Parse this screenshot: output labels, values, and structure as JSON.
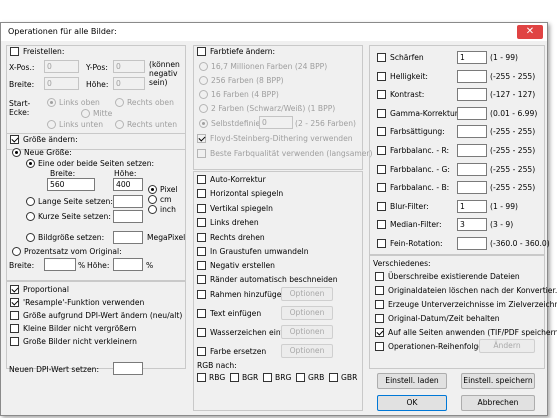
{
  "dialog": {
    "title": "Operationen für alle Bilder:",
    "close_glyph": "✕"
  },
  "freistellen": {
    "checkbox_label": "Freistellen:",
    "xpos_label": "X-Pos.:",
    "xpos_value": "0",
    "ypos_label": "Y-Pos:",
    "ypos_value": "0",
    "negativ_note": "(können negativ sein)",
    "breite_label": "Breite:",
    "breite_value": "0",
    "hoehe_label": "Höhe:",
    "hoehe_value": "0",
    "startecke_label": "Start-Ecke:",
    "options": {
      "links_oben": "Links oben",
      "rechts_oben": "Rechts oben",
      "mitte": "Mitte",
      "links_unten": "Links unten",
      "rechts_unten": "Rechts unten"
    }
  },
  "groesse": {
    "checkbox_label": "Größe ändern:",
    "neue_groesse": "Neue Größe:",
    "eine_oder_beide": "Eine oder beide Seiten setzen:",
    "breite_label": "Breite:",
    "breite_value": "560",
    "hoehe_label": "Höhe:",
    "hoehe_value": "400",
    "unit_pixel": "Pixel",
    "unit_cm": "cm",
    "unit_inch": "inch",
    "lange_seite": "Lange Seite setzen:",
    "kurze_seite": "Kurze Seite setzen:",
    "bildgroesse": "Bildgröße setzen:",
    "megapixel": "MegaPixel",
    "prozentsatz": "Prozentsatz vom Original:",
    "p_breite_label": "Breite:",
    "p_hoehe_label": "Höhe:",
    "percent_sign": "%",
    "proportional": "Proportional",
    "resample": "'Resample'-Funktion verwenden",
    "dpi_wert": "Größe aufgrund DPI-Wert ändern (neu/alt)",
    "kleine_bilder": "Kleine Bilder nicht vergrößern",
    "grosse_bilder": "Große Bilder nicht verkleinern",
    "neuer_dpi": "Neuen DPI-Wert setzen:"
  },
  "farbtiefe": {
    "checkbox_label": "Farbtiefe ändern:",
    "options": [
      "16,7 Millionen Farben (24 BPP)",
      "256 Farben (8 BPP)",
      "16 Farben (4 BPP)",
      "2 Farben (Schwarz/Weiß) (1 BPP)"
    ],
    "selbstdefiniert": "Selbstdefiniert:",
    "selbst_value": "0",
    "selbst_range": "(2 - 256 Farben)",
    "floyd": "Floyd-Steinberg-Dithering verwenden",
    "beste": "Beste Farbqualität verwenden (langsamer)"
  },
  "effekte": {
    "auto_korrektur": "Auto-Korrektur",
    "horizontal": "Horizontal spiegeln",
    "vertikal": "Vertikal spiegeln",
    "links_drehen": "Links drehen",
    "rechts_drehen": "Rechts drehen",
    "graustufen": "In Graustufen umwandeln",
    "negativ": "Negativ erstellen",
    "raender": "Ränder automatisch beschneiden",
    "rahmen": "Rahmen hinzufügen",
    "text": "Text einfügen",
    "wasserzeichen": "Wasserzeichen einf.",
    "farbe": "Farbe ersetzen",
    "optionen_label": "Optionen",
    "rgb_nach": "RGB nach:",
    "rgb_options": [
      "RBG",
      "BGR",
      "BRG",
      "GRB",
      "GBR"
    ]
  },
  "adjust": [
    {
      "label": "Schärfen",
      "value": "1",
      "range": "(1 - 99)"
    },
    {
      "label": "Helligkeit:",
      "value": "",
      "range": "(-255 - 255)"
    },
    {
      "label": "Kontrast:",
      "value": "",
      "range": "(-127 - 127)"
    },
    {
      "label": "Gamma-Korrektur:",
      "value": "",
      "range": "(0.01 - 6.99)"
    },
    {
      "label": "Farbsättigung:",
      "value": "",
      "range": "(-255 - 255)"
    },
    {
      "label": "Farbbalanc. - R:",
      "value": "",
      "range": "(-255 - 255)"
    },
    {
      "label": "Farbbalanc. - G:",
      "value": "",
      "range": "(-255 - 255)"
    },
    {
      "label": "Farbbalanc. - B:",
      "value": "",
      "range": "(-255 - 255)"
    },
    {
      "label": "Blur-Filter:",
      "value": "1",
      "range": "(1 - 99)"
    },
    {
      "label": "Median-Filter:",
      "value": "3",
      "range": "(3 - 9)"
    },
    {
      "label": "Fein-Rotation:",
      "value": "",
      "range": "(-360.0 - 360.0)"
    }
  ],
  "verschiedenes": {
    "heading": "Verschiedenes:",
    "ueberschreibe": "Überschreibe existierende Dateien",
    "originaldateien": "Originaldateien löschen nach der Konvertier.",
    "unterverzeichnisse": "Erzeuge Unterverzeichnisse im Zielverzeichn.",
    "datum": "Original-Datum/Zeit behalten",
    "auf_alle": "Auf alle Seiten anwenden (TIF/PDF speichern)",
    "reihenfolge": "Operationen-Reihenfolge",
    "aendern": "Ändern"
  },
  "buttons": {
    "einstell_laden": "Einstell. laden",
    "einstell_speichern": "Einstell. speichern",
    "ok": "OK",
    "abbrechen": "Abbrechen"
  }
}
